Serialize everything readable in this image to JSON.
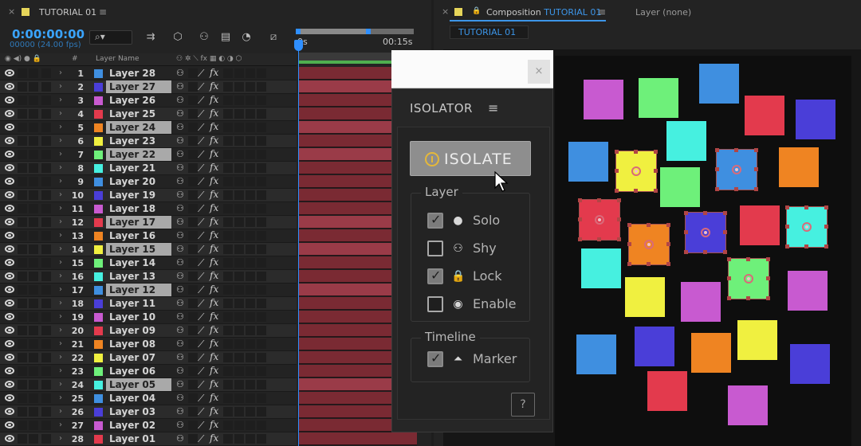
{
  "timeline": {
    "tab_close": "×",
    "tab_title": "TUTORIAL 01",
    "tab_menu": "≡",
    "timecode": "0:00:00:00",
    "frames_fps": "00000 (24.00 fps)",
    "search_icon_glyph": "⌕▾",
    "ruler_start": "0s",
    "ruler_end": "00:15s",
    "column_header_number": "#",
    "column_header_layer_name": "Layer Name",
    "layers": [
      {
        "num": "1",
        "name": "Layer 28",
        "color": "#3f8fe0",
        "selected": false
      },
      {
        "num": "2",
        "name": "Layer 27",
        "color": "#4a3ed8",
        "selected": true
      },
      {
        "num": "3",
        "name": "Layer 26",
        "color": "#c85ad0",
        "selected": false
      },
      {
        "num": "4",
        "name": "Layer 25",
        "color": "#e33a4d",
        "selected": false
      },
      {
        "num": "5",
        "name": "Layer 24",
        "color": "#ef8422",
        "selected": true
      },
      {
        "num": "6",
        "name": "Layer 23",
        "color": "#f0f040",
        "selected": false
      },
      {
        "num": "7",
        "name": "Layer 22",
        "color": "#6ef07a",
        "selected": true
      },
      {
        "num": "8",
        "name": "Layer 21",
        "color": "#46f0e0",
        "selected": false
      },
      {
        "num": "9",
        "name": "Layer 20",
        "color": "#3f8fe0",
        "selected": false
      },
      {
        "num": "10",
        "name": "Layer 19",
        "color": "#4a3ed8",
        "selected": false
      },
      {
        "num": "11",
        "name": "Layer 18",
        "color": "#c85ad0",
        "selected": false
      },
      {
        "num": "12",
        "name": "Layer 17",
        "color": "#e33a4d",
        "selected": true
      },
      {
        "num": "13",
        "name": "Layer 16",
        "color": "#ef8422",
        "selected": false
      },
      {
        "num": "14",
        "name": "Layer 15",
        "color": "#f0f040",
        "selected": true
      },
      {
        "num": "15",
        "name": "Layer 14",
        "color": "#6ef07a",
        "selected": false
      },
      {
        "num": "16",
        "name": "Layer 13",
        "color": "#46f0e0",
        "selected": false
      },
      {
        "num": "17",
        "name": "Layer 12",
        "color": "#3f8fe0",
        "selected": true
      },
      {
        "num": "18",
        "name": "Layer 11",
        "color": "#4a3ed8",
        "selected": false
      },
      {
        "num": "19",
        "name": "Layer 10",
        "color": "#c85ad0",
        "selected": false
      },
      {
        "num": "20",
        "name": "Layer 09",
        "color": "#e33a4d",
        "selected": false
      },
      {
        "num": "21",
        "name": "Layer 08",
        "color": "#ef8422",
        "selected": false
      },
      {
        "num": "22",
        "name": "Layer 07",
        "color": "#f0f040",
        "selected": false
      },
      {
        "num": "23",
        "name": "Layer 06",
        "color": "#6ef07a",
        "selected": false
      },
      {
        "num": "24",
        "name": "Layer 05",
        "color": "#46f0e0",
        "selected": true
      },
      {
        "num": "25",
        "name": "Layer 04",
        "color": "#3f8fe0",
        "selected": false
      },
      {
        "num": "26",
        "name": "Layer 03",
        "color": "#4a3ed8",
        "selected": false
      },
      {
        "num": "27",
        "name": "Layer 02",
        "color": "#c85ad0",
        "selected": false
      },
      {
        "num": "28",
        "name": "Layer 01",
        "color": "#e33a4d",
        "selected": false
      }
    ]
  },
  "composition": {
    "tab_close": "×",
    "lock_icon": "🔒",
    "tab_prefix": "Composition",
    "tab_name": "TUTORIAL 01",
    "tab_menu": "≡",
    "layer_tab": "Layer (none)",
    "subtab": "TUTORIAL 01"
  },
  "isolator": {
    "close": "×",
    "title": "ISOLATOR",
    "menu": "≡",
    "button_label": "ISOLATE",
    "layer_group_title": "Layer",
    "layer_options": [
      {
        "label": "Solo",
        "icon": "●",
        "checked": true
      },
      {
        "label": "Shy",
        "icon": "⚇",
        "checked": false
      },
      {
        "label": "Lock",
        "icon": "🔒",
        "checked": true
      },
      {
        "label": "Enable",
        "icon": "◉",
        "checked": false
      }
    ],
    "timeline_group_title": "Timeline",
    "timeline_options": [
      {
        "label": "Marker",
        "icon": "⏶",
        "checked": true
      }
    ],
    "help": "?"
  }
}
